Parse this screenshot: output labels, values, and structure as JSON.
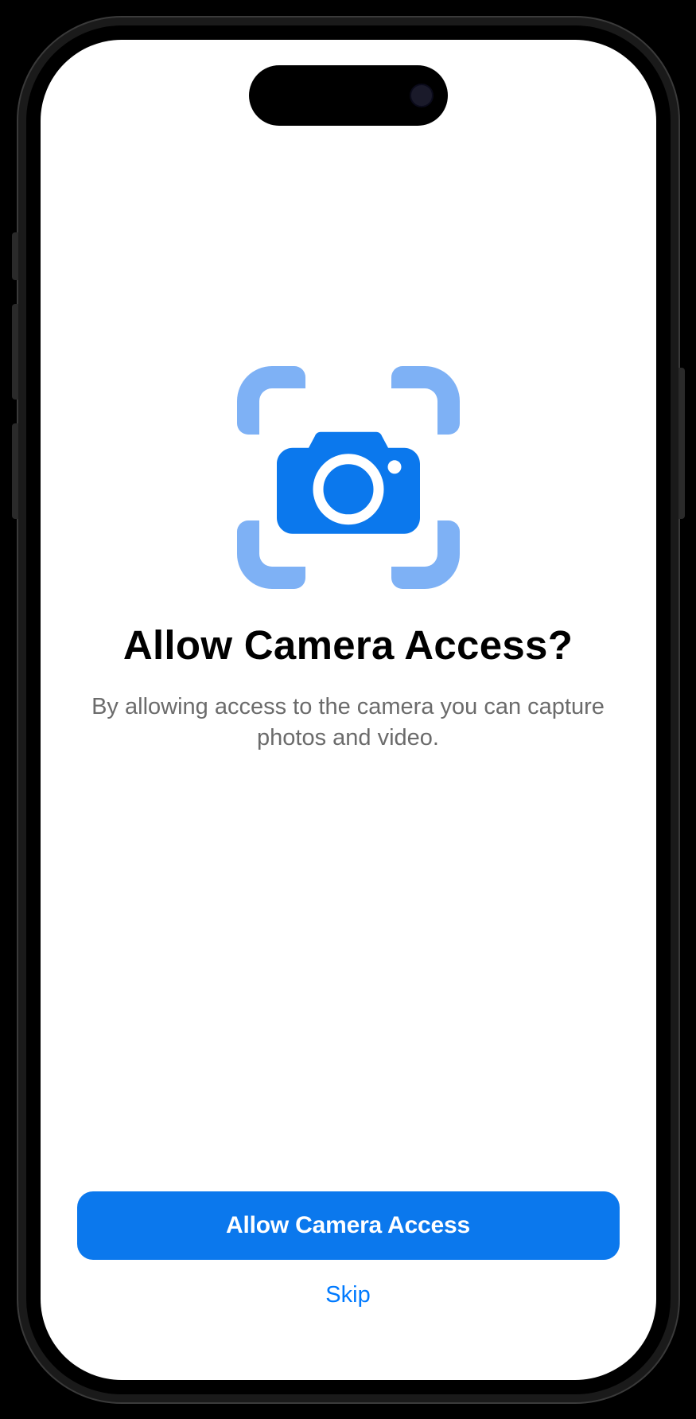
{
  "heading": "Allow Camera Access?",
  "subtext": "By allowing access to the camera you can capture photos and video.",
  "primary_button_label": "Allow Camera Access",
  "secondary_button_label": "Skip",
  "colors": {
    "primary": "#0b78ed",
    "viewfinder": "#7eb1f5",
    "link": "#007aff"
  }
}
